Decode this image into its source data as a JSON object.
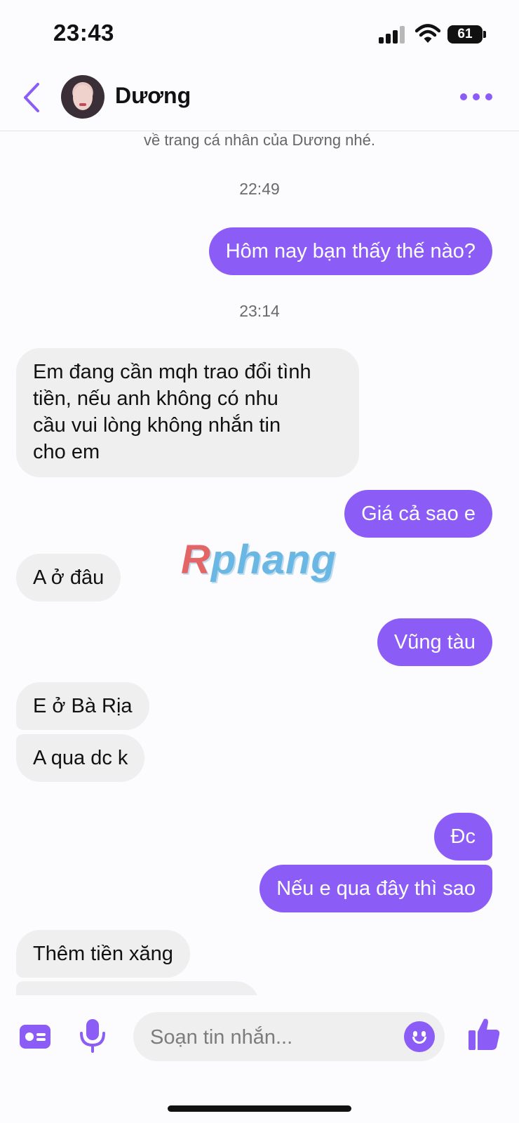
{
  "status_bar": {
    "time": "23:43",
    "battery": "61"
  },
  "header": {
    "contact_name": "Dương"
  },
  "chat": {
    "system_note_clipped": "về trang cá nhân của Dương nhé.",
    "messages": [
      {
        "kind": "timestamp",
        "text": "22:49"
      },
      {
        "kind": "outgoing",
        "text": "Hôm nay bạn thấy thế nào?"
      },
      {
        "kind": "timestamp",
        "text": "23:14"
      },
      {
        "kind": "incoming",
        "lines": [
          "Em đang cần mqh trao đổi tình",
          "tiền, nếu anh không có nhu",
          "cầu vui lòng không nhắn tin",
          "cho em"
        ]
      },
      {
        "kind": "outgoing",
        "text": "Giá cả sao e"
      },
      {
        "kind": "incoming",
        "text": "A ở đâu"
      },
      {
        "kind": "outgoing",
        "text": "Vũng tàu"
      },
      {
        "kind": "incoming",
        "text": "E ở Bà Rịa"
      },
      {
        "kind": "incoming",
        "text": "A qua dc k"
      },
      {
        "kind": "outgoing",
        "text": "Đc"
      },
      {
        "kind": "outgoing",
        "text": "Nếu e qua đây thì sao"
      },
      {
        "kind": "incoming",
        "text": "Thêm tiền xăng"
      }
    ],
    "watermark": {
      "first": "R",
      "rest": "phang"
    }
  },
  "composer": {
    "placeholder": "Soạn tin nhắn..."
  },
  "colors": {
    "accent": "#8b5cf6",
    "incoming_bubble": "#efefef",
    "background": "#fcfbfd"
  },
  "icons": [
    "contact-card-icon",
    "microphone-icon",
    "emoji-icon",
    "thumbs-up-icon",
    "back-chevron-icon",
    "more-dots-icon"
  ]
}
